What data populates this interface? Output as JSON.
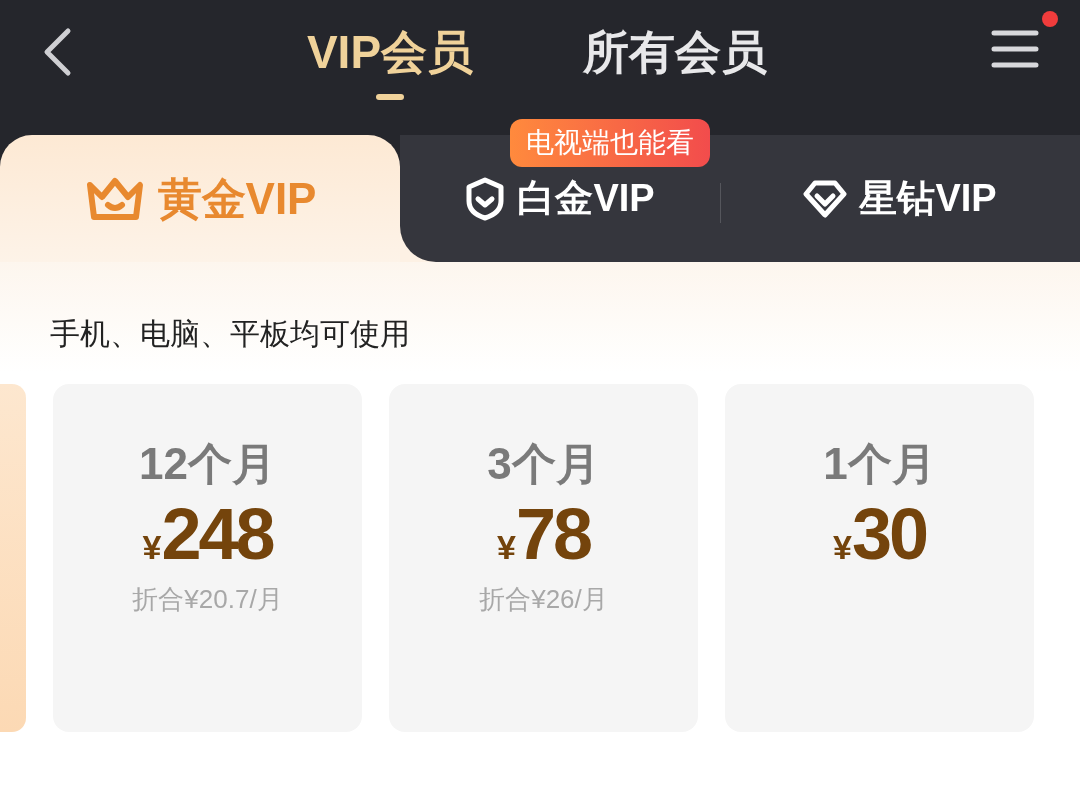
{
  "header": {
    "tabs": [
      {
        "label": "VIP会员",
        "selected": true
      },
      {
        "label": "所有会员",
        "selected": false
      }
    ],
    "menu": {
      "notification": true
    }
  },
  "tiers": [
    {
      "label": "黄金VIP",
      "selected": true
    },
    {
      "label": "白金VIP",
      "selected": false,
      "badge": "电视端也能看"
    },
    {
      "label": "星钻VIP",
      "selected": false
    }
  ],
  "description": "手机、电脑、平板均可使用",
  "plans": [
    {
      "period": "12个月",
      "currency": "¥",
      "price": "248",
      "note": "折合¥20.7/月"
    },
    {
      "period": "3个月",
      "currency": "¥",
      "price": "78",
      "note": "折合¥26/月"
    },
    {
      "period": "1个月",
      "currency": "¥",
      "price": "30"
    }
  ]
}
